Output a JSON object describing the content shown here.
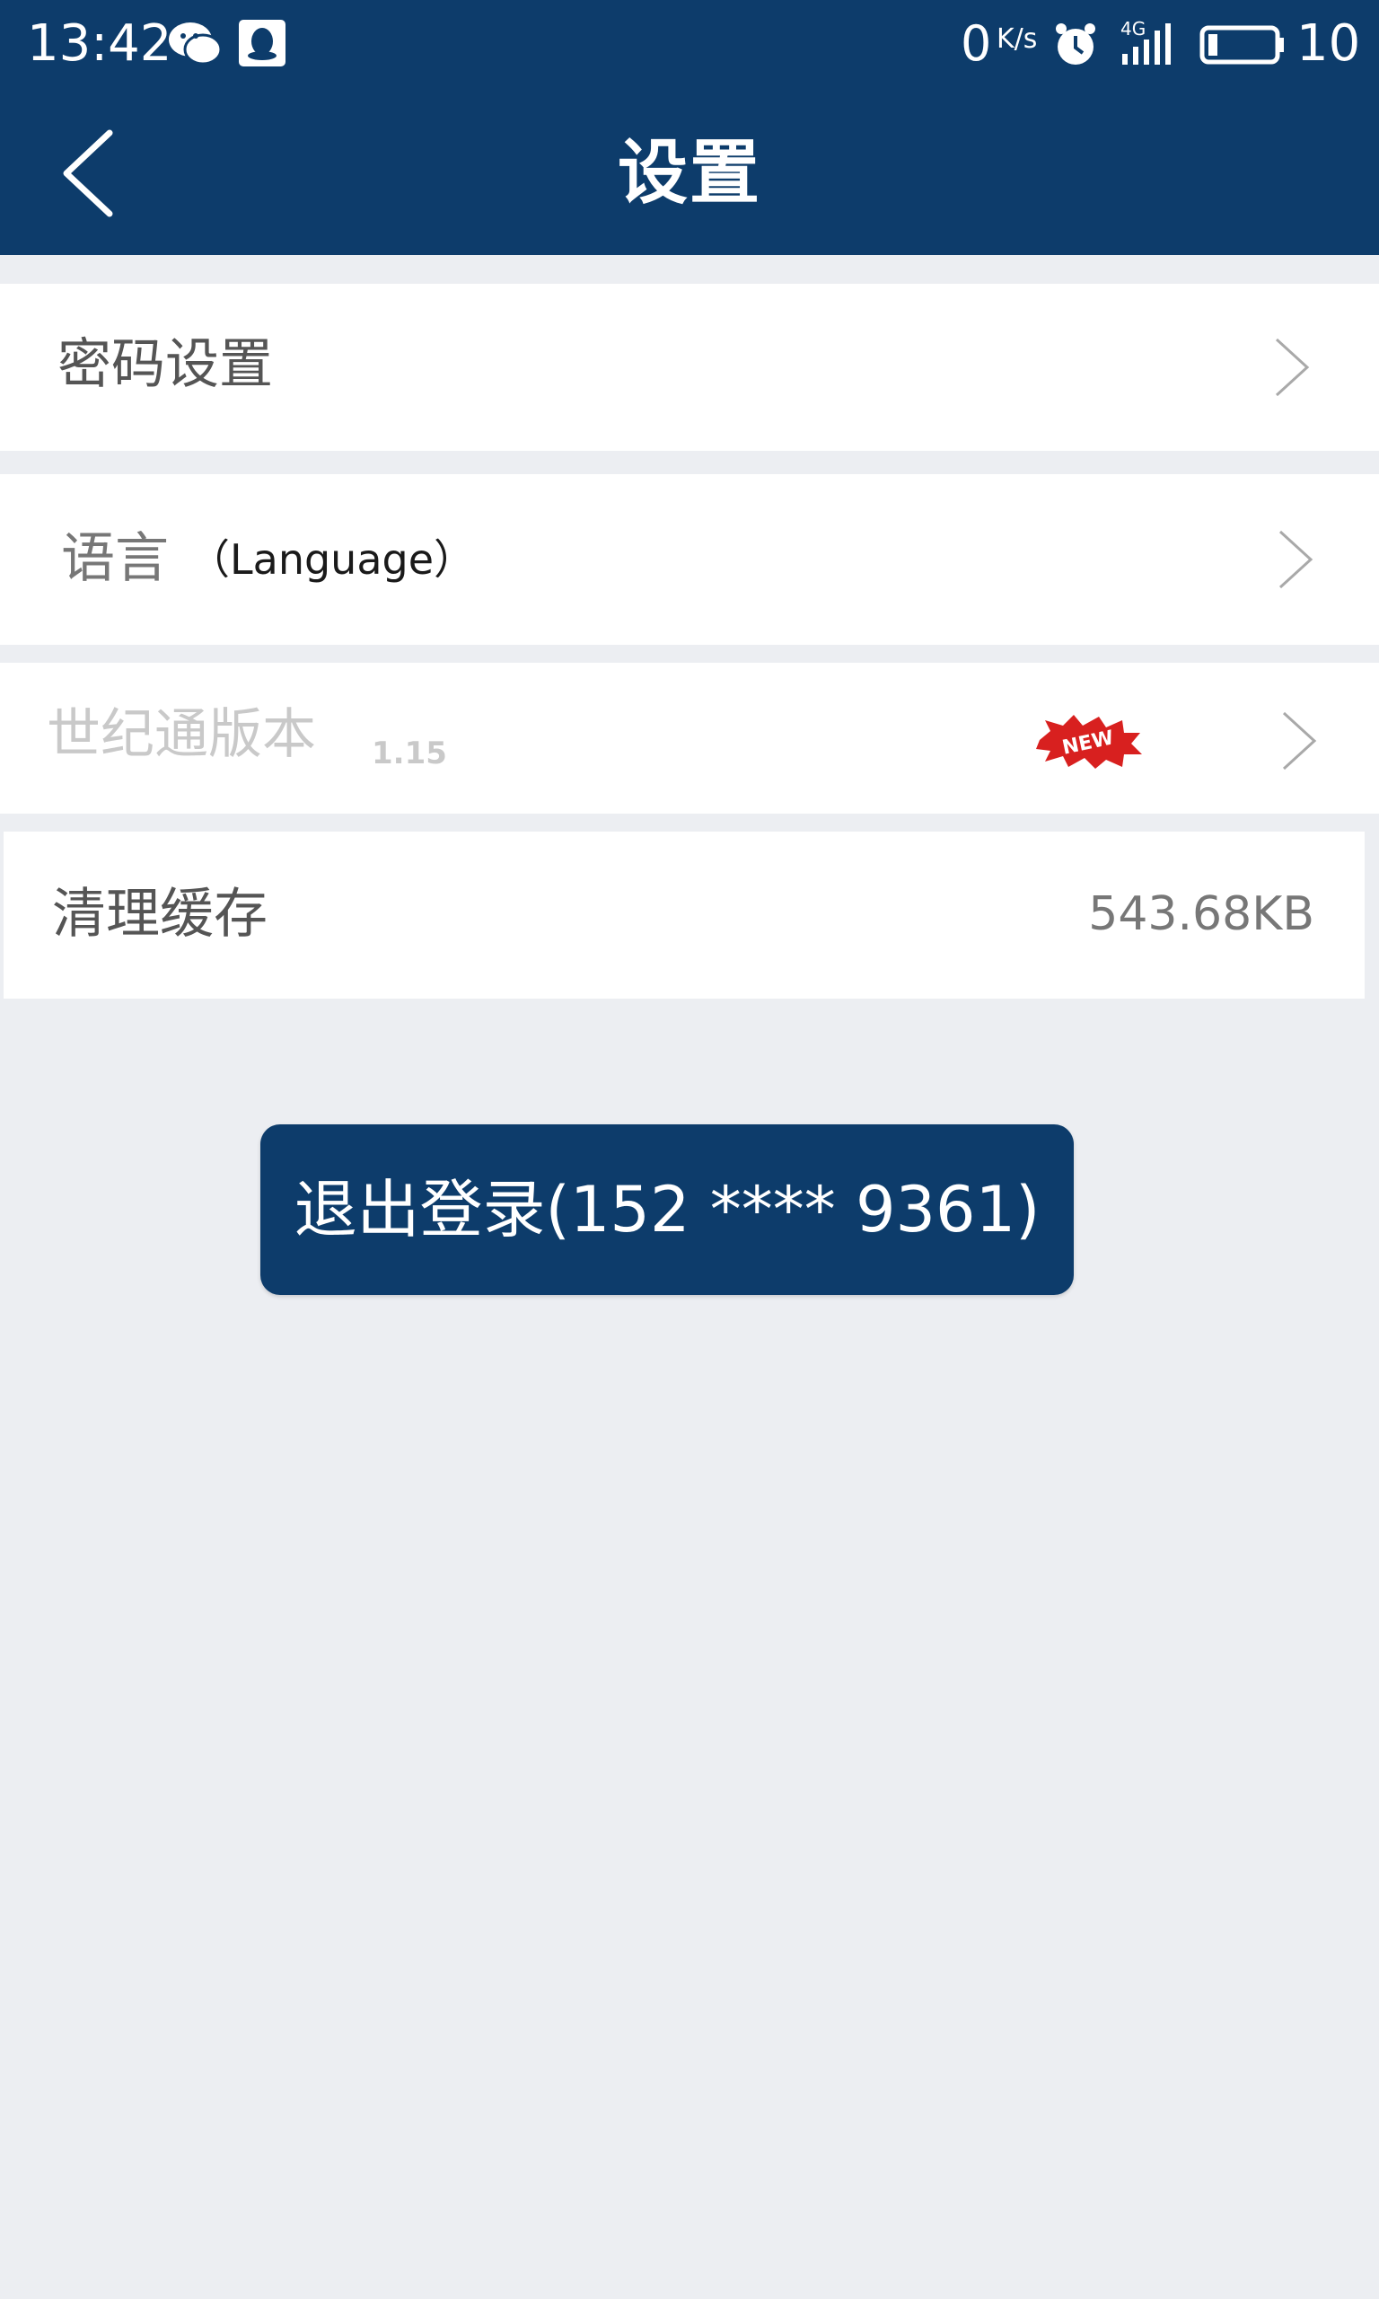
{
  "status_bar": {
    "time": "13:42",
    "net_speed": "0",
    "net_speed_unit": "K/s",
    "signal_label": "4G",
    "battery": "10"
  },
  "nav": {
    "title": "设置"
  },
  "menu": {
    "password": {
      "label": "密码设置"
    },
    "language": {
      "label": "语言",
      "sub": "（Language）"
    },
    "version": {
      "label": "世纪通版本",
      "value": "1.15",
      "badge": "NEW"
    },
    "cache": {
      "label": "清理缓存",
      "value": "543.68KB"
    }
  },
  "logout": {
    "label": "退出登录(152 **** 9361)"
  },
  "colors": {
    "primary": "#0d3c6b",
    "background": "#eceef2",
    "badge": "#d8201f"
  }
}
